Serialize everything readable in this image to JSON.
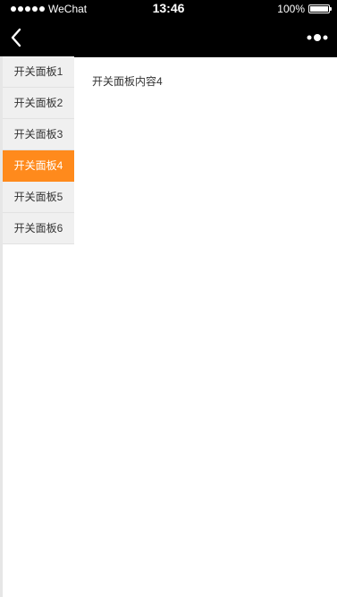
{
  "status_bar": {
    "carrier": "WeChat",
    "time": "13:46",
    "battery": "100%",
    "battery_level": 1.0
  },
  "nav_bar": {
    "back_icon": "chevron-left-icon",
    "more_icon": "more-dots-icon"
  },
  "sidebar": {
    "items": [
      {
        "label": "开关面板1",
        "active": false
      },
      {
        "label": "开关面板2",
        "active": false
      },
      {
        "label": "开关面板3",
        "active": false
      },
      {
        "label": "开关面板4",
        "active": true
      },
      {
        "label": "开关面板5",
        "active": false
      },
      {
        "label": "开关面板6",
        "active": false
      }
    ]
  },
  "content": {
    "text": "开关面板内容4"
  },
  "colors": {
    "active_tab": "#ff8a1c",
    "sidebar_bg": "#f0f0f0",
    "bar_bg": "#000000"
  }
}
